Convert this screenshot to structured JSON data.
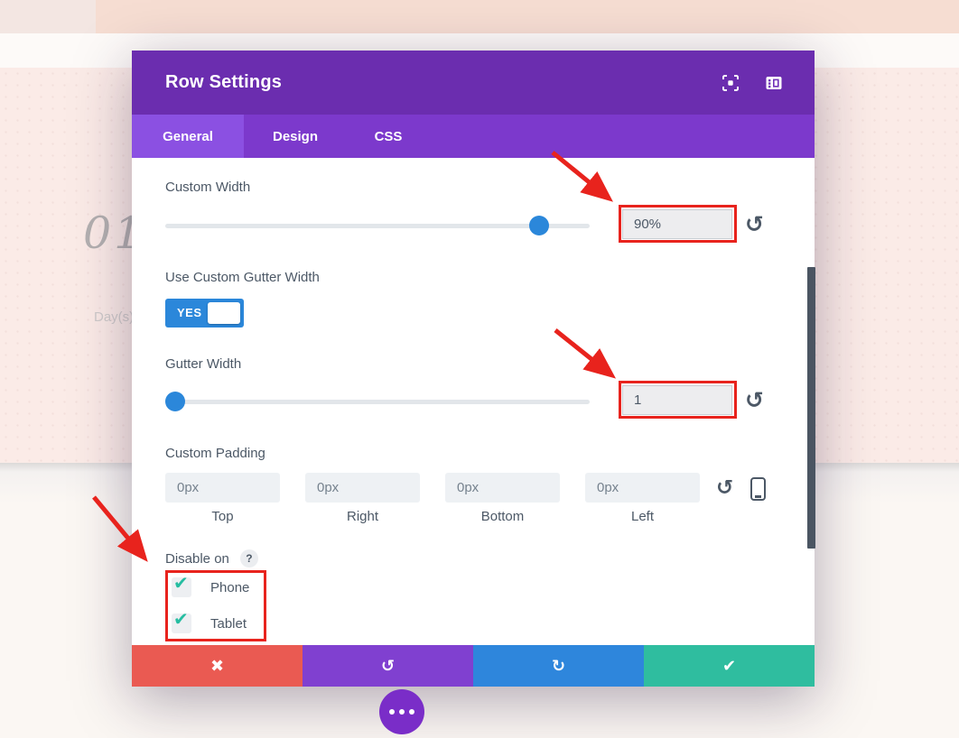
{
  "modal": {
    "title": "Row Settings",
    "header_icons": [
      {
        "name": "expand-modal"
      },
      {
        "name": "dock-modal"
      }
    ],
    "tabs": [
      {
        "label": "General",
        "active": true
      },
      {
        "label": "Design",
        "active": false
      },
      {
        "label": "CSS",
        "active": false
      }
    ],
    "sections": {
      "custom_width": {
        "label": "Custom Width",
        "value": "90%",
        "slider_percent": 90
      },
      "gutter_toggle": {
        "label": "Use Custom Gutter Width",
        "value": "YES",
        "state": "on"
      },
      "gutter_width": {
        "label": "Gutter Width",
        "value": "1",
        "slider_percent": 0
      },
      "custom_padding": {
        "label": "Custom Padding",
        "fields": [
          {
            "value": "0px",
            "side": "Top"
          },
          {
            "value": "0px",
            "side": "Right"
          },
          {
            "value": "0px",
            "side": "Bottom"
          },
          {
            "value": "0px",
            "side": "Left"
          }
        ]
      },
      "disable_on": {
        "label": "Disable on",
        "help_badge": "?",
        "check_glyph": "✔",
        "options": [
          {
            "label": "Phone",
            "checked": true
          },
          {
            "label": "Tablet",
            "checked": true
          }
        ]
      }
    },
    "reset_glyph": "↺",
    "footer_buttons": [
      {
        "name": "cancel",
        "glyph": "✖",
        "color": "#ea5a52"
      },
      {
        "name": "undo",
        "glyph": "↺",
        "color": "#8040d0"
      },
      {
        "name": "redo",
        "glyph": "↻",
        "color": "#2e86dc"
      },
      {
        "name": "save",
        "glyph": "✔",
        "color": "#2fbd9f"
      }
    ]
  },
  "page_background": {
    "heading_fragment": "01",
    "subheading_fragment": "Day(s)"
  },
  "colors": {
    "header_purple": "#6b2daf",
    "tabbar_purple": "#7c39cc",
    "active_tab_purple": "#8b50e2",
    "accent_blue": "#2b87da",
    "check_teal": "#26bda1",
    "annotation_red": "#e8231d",
    "label_slate": "#4c5866"
  }
}
